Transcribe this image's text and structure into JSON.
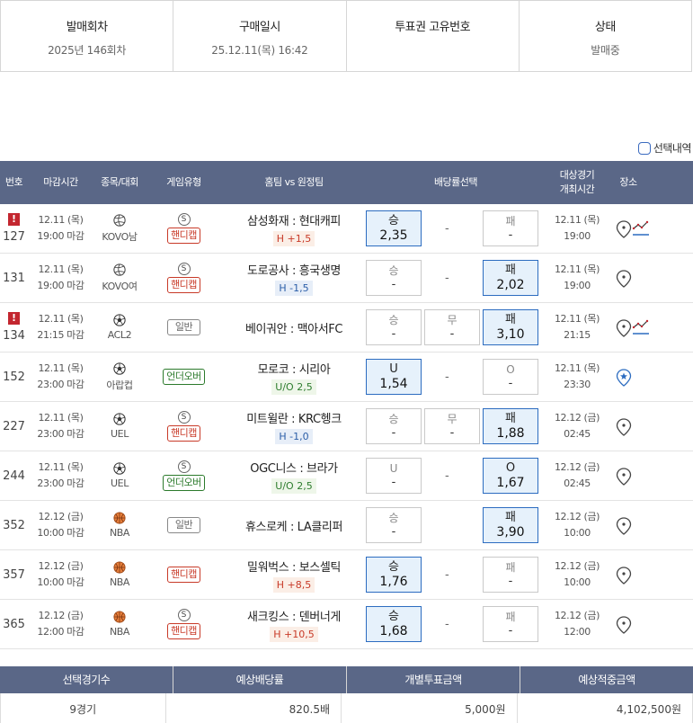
{
  "info": {
    "headers": [
      "발매회차",
      "구매일시",
      "투표권 고유번호",
      "상태"
    ],
    "values": [
      "2025년 146회차",
      "25.12.11(목) 16:42",
      "",
      "발매중"
    ]
  },
  "legend": {
    "label": "선택내역"
  },
  "table": {
    "headers": {
      "no": "번호",
      "deadline": "마감시간",
      "sport": "종목/대회",
      "game_type": "게임유형",
      "teams": "홈팀 vs 원정팀",
      "odds": "배당률선택",
      "date_line1": "대상경기",
      "date_line2": "개최시간",
      "place": "장소"
    },
    "rows": [
      {
        "no": "127",
        "warn": "!",
        "dl1": "12.11 (목)",
        "dl2": "19:00 마감",
        "sport": "volleyball",
        "league": "KOVO남",
        "s": "S",
        "type": "핸디캡",
        "tagc": "hc",
        "teams": "삼성화재 : 현대캐피",
        "hl": "H +1,5",
        "hlc": "h",
        "o1l": "승",
        "o1v": "2,35",
        "o2l": "",
        "o2v": "-",
        "o3l": "패",
        "o3v": "-",
        "sel": 1,
        "date1": "12.11 (목)",
        "date2": "19:00",
        "trend": true
      },
      {
        "no": "131",
        "warn": "",
        "dl1": "12.11 (목)",
        "dl2": "19:00 마감",
        "sport": "volleyball",
        "league": "KOVO여",
        "s": "S",
        "type": "핸디캡",
        "tagc": "hc",
        "teams": "도로공사 : 흥국생명",
        "hl": "H -1,5",
        "hlc": "h neg",
        "o1l": "승",
        "o1v": "-",
        "o2l": "",
        "o2v": "-",
        "o3l": "패",
        "o3v": "2,02",
        "sel": 3,
        "date1": "12.11 (목)",
        "date2": "19:00",
        "trend": false
      },
      {
        "no": "134",
        "warn": "!",
        "dl1": "12.11 (목)",
        "dl2": "21:15 마감",
        "sport": "soccer",
        "league": "ACL2",
        "s": "",
        "type": "일반",
        "tagc": "gen",
        "teams": "베이궈안 : 맥아서FC",
        "hl": "",
        "hlc": "",
        "o1l": "승",
        "o1v": "-",
        "o2l": "무",
        "o2v": "-",
        "o3l": "패",
        "o3v": "3,10",
        "sel": 3,
        "date1": "12.11 (목)",
        "date2": "21:15",
        "trend": true
      },
      {
        "no": "152",
        "warn": "",
        "dl1": "12.11 (목)",
        "dl2": "23:00 마감",
        "sport": "soccer",
        "league": "아랍컵",
        "s": "",
        "type": "언더오버",
        "tagc": "ou",
        "teams": "모로코 : 시리아",
        "hl": "U/O 2,5",
        "hlc": "uo",
        "o1l": "U",
        "o1v": "1,54",
        "o2l": "",
        "o2v": "-",
        "o3l": "O",
        "o3v": "-",
        "sel": 1,
        "date1": "12.11 (목)",
        "date2": "23:30",
        "trend": false,
        "star": true
      },
      {
        "no": "227",
        "warn": "",
        "dl1": "12.11 (목)",
        "dl2": "23:00 마감",
        "sport": "soccer",
        "league": "UEL",
        "s": "S",
        "type": "핸디캡",
        "tagc": "hc",
        "teams": "미트윌란 : KRC헹크",
        "hl": "H -1,0",
        "hlc": "h neg",
        "o1l": "승",
        "o1v": "-",
        "o2l": "무",
        "o2v": "-",
        "o3l": "패",
        "o3v": "1,88",
        "sel": 3,
        "date1": "12.12 (금)",
        "date2": "02:45",
        "trend": false
      },
      {
        "no": "244",
        "warn": "",
        "dl1": "12.11 (목)",
        "dl2": "23:00 마감",
        "sport": "soccer",
        "league": "UEL",
        "s": "S",
        "type": "언더오버",
        "tagc": "ou",
        "teams": "OGC니스 : 브라가",
        "hl": "U/O 2,5",
        "hlc": "uo",
        "o1l": "U",
        "o1v": "-",
        "o2l": "",
        "o2v": "-",
        "o3l": "O",
        "o3v": "1,67",
        "sel": 3,
        "date1": "12.12 (금)",
        "date2": "02:45",
        "trend": false
      },
      {
        "no": "352",
        "warn": "",
        "dl1": "12.12 (금)",
        "dl2": "10:00 마감",
        "sport": "basketball",
        "league": "NBA",
        "s": "",
        "type": "일반",
        "tagc": "gen",
        "teams": "휴스로케 : LA클리퍼",
        "hl": "",
        "hlc": "",
        "o1l": "승",
        "o1v": "-",
        "o2l": "",
        "o2v": "",
        "o3l": "패",
        "o3v": "3,90",
        "sel": 3,
        "date1": "12.12 (금)",
        "date2": "10:00",
        "trend": false,
        "nodash": true
      },
      {
        "no": "357",
        "warn": "",
        "dl1": "12.12 (금)",
        "dl2": "10:00 마감",
        "sport": "basketball",
        "league": "NBA",
        "s": "",
        "type": "핸디캡",
        "tagc": "hc",
        "teams": "밀워벅스 : 보스셀틱",
        "hl": "H +8,5",
        "hlc": "h",
        "o1l": "승",
        "o1v": "1,76",
        "o2l": "",
        "o2v": "-",
        "o3l": "패",
        "o3v": "-",
        "sel": 1,
        "date1": "12.12 (금)",
        "date2": "10:00",
        "trend": false
      },
      {
        "no": "365",
        "warn": "",
        "dl1": "12.12 (금)",
        "dl2": "12:00 마감",
        "sport": "basketball",
        "league": "NBA",
        "s": "S",
        "type": "핸디캡",
        "tagc": "hc",
        "teams": "새크킹스 : 덴버너게",
        "hl": "H +10,5",
        "hlc": "h",
        "o1l": "승",
        "o1v": "1,68",
        "o2l": "",
        "o2v": "-",
        "o3l": "패",
        "o3v": "-",
        "sel": 1,
        "date1": "12.12 (금)",
        "date2": "12:00",
        "trend": false
      }
    ]
  },
  "summary": {
    "headers": [
      "선택경기수",
      "예상배당률",
      "개별투표금액",
      "예상적중금액"
    ],
    "values": [
      "9경기",
      "820.5배",
      "5,000원",
      "4,102,500원"
    ]
  },
  "colors": {
    "header_bg": "#5a6787",
    "selected_bg": "#e6f1fb",
    "selected_border": "#2c6cc0",
    "handicap_red": "#c83a28",
    "overunder_green": "#2b7a2b",
    "warn_red": "#c3262f"
  },
  "icons": {
    "volleyball": "volleyball-icon",
    "soccer": "soccer-ball-icon",
    "basketball": "basketball-icon",
    "place": "map-pin-icon",
    "trend": "trend-chart-icon",
    "star": "star-pin-icon"
  }
}
